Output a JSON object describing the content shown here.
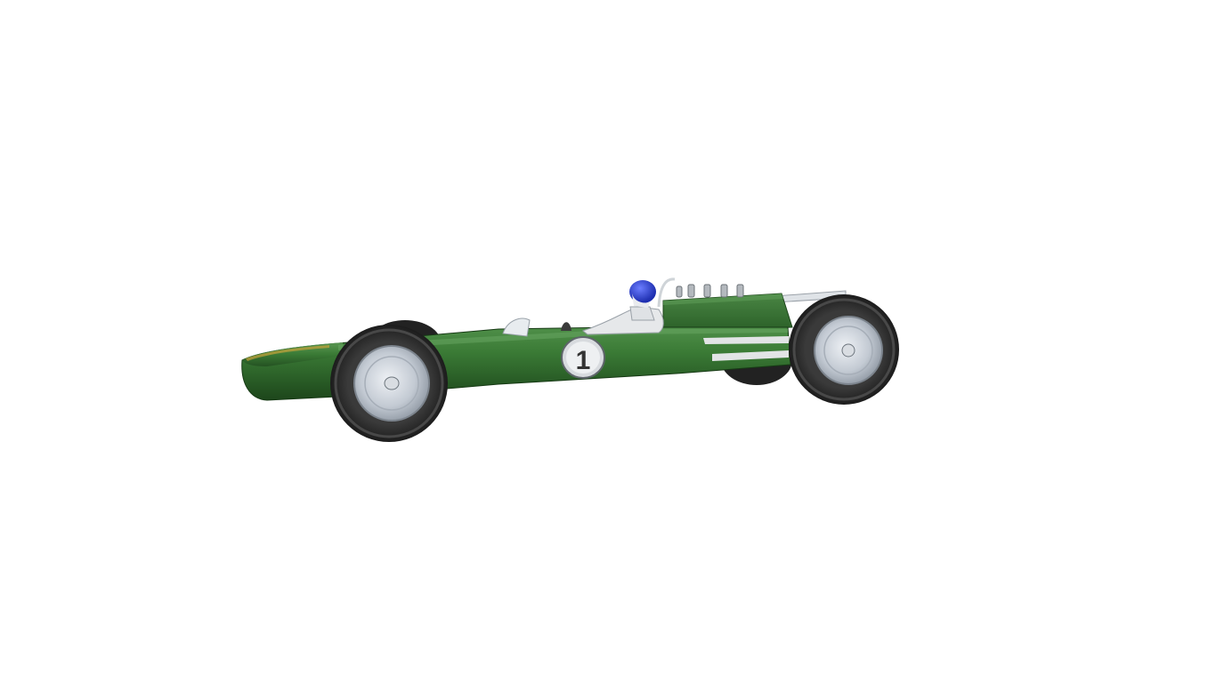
{
  "scene": {
    "background": "#ffffff",
    "subject": "race-car",
    "car": {
      "body_color": "#2e6a2a",
      "stripe_color": "#d9d9d9",
      "race_number": "1",
      "helmet_color": "#2a3fcf",
      "wheel_color": "#c9cfd6",
      "tire_color": "#2b2b2b"
    }
  }
}
